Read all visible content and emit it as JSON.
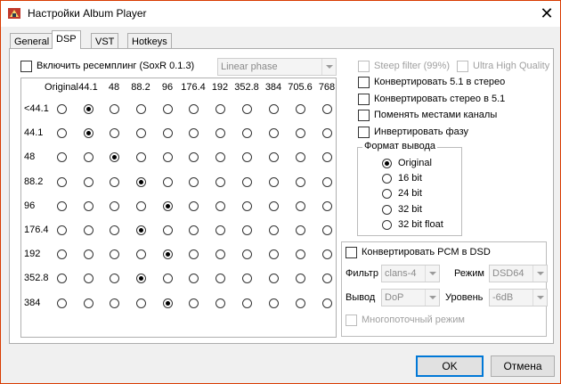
{
  "window": {
    "title": "Настройки Album Player",
    "close_glyph": "✕",
    "app_icon": "album-player-icon"
  },
  "tabs": [
    {
      "label": "General"
    },
    {
      "label": "DSP"
    },
    {
      "label": "VST"
    },
    {
      "label": "Hotkeys"
    }
  ],
  "resample": {
    "label": "Включить ресемплинг (SoxR 0.1.3)",
    "checked": false,
    "phase_value": "Linear phase"
  },
  "matrix": {
    "columns": [
      "Original",
      "44.1",
      "48",
      "88.2",
      "96",
      "176.4",
      "192",
      "352.8",
      "384",
      "705.6",
      "768"
    ],
    "rows": [
      {
        "label": "<44.1",
        "selected": 1
      },
      {
        "label": "44.1",
        "selected": 1
      },
      {
        "label": "48",
        "selected": 2
      },
      {
        "label": "88.2",
        "selected": 3
      },
      {
        "label": "96",
        "selected": 4
      },
      {
        "label": "176.4",
        "selected": 3
      },
      {
        "label": "192",
        "selected": 4
      },
      {
        "label": "352.8",
        "selected": 3
      },
      {
        "label": "384",
        "selected": 4
      }
    ]
  },
  "options": {
    "steep_filter": "Steep filter (99%)",
    "ultra_high_quality": "Ultra High Quality",
    "convert_51_stereo": "Конвертировать 5.1 в стерео",
    "convert_stereo_51": "Конвертировать стерео в 5.1",
    "swap_channels": "Поменять местами каналы",
    "invert_phase": "Инвертировать фазу"
  },
  "output_format": {
    "title": "Формат вывода",
    "selected": 0,
    "items": [
      "Original",
      "16 bit",
      "24 bit",
      "32 bit",
      "32 bit float"
    ]
  },
  "dsd": {
    "convert_label": "Конвертировать PCM в DSD",
    "filter_label": "Фильтр",
    "filter_value": "clans-4",
    "mode_label": "Режим",
    "mode_value": "DSD64",
    "output_label": "Вывод",
    "output_value": "DoP",
    "level_label": "Уровень",
    "level_value": "-6dB",
    "multithread_label": "Многопоточный режим"
  },
  "buttons": {
    "ok": "OK",
    "cancel": "Отмена"
  },
  "colors": {
    "window_border": "#d83b01",
    "default_button_border": "#0078d7"
  }
}
